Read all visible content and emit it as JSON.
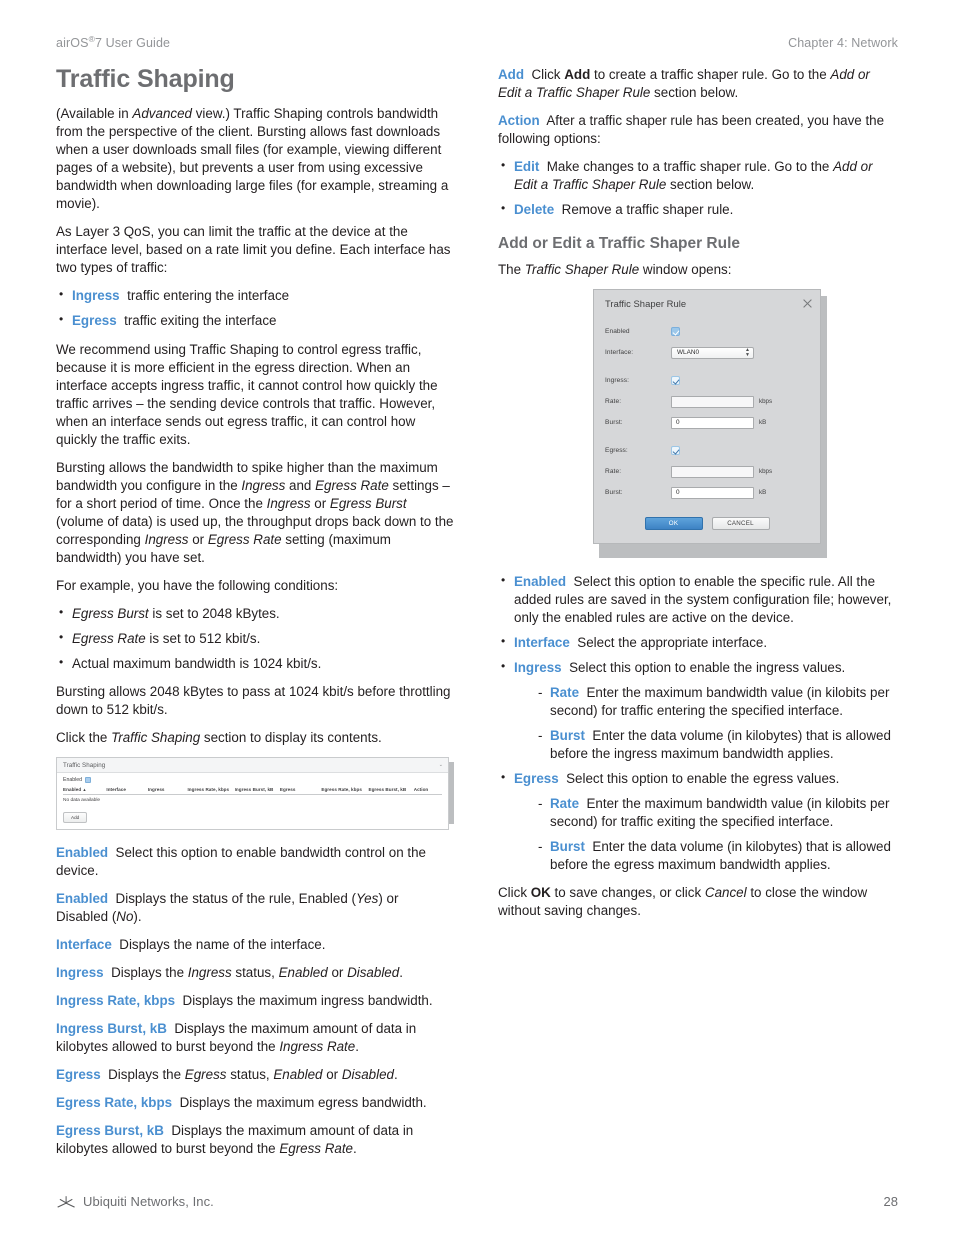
{
  "runhead": {
    "left_prefix": "airOS",
    "left_sup": "®",
    "left_suffix": "7 User Guide",
    "right": "Chapter 4: Network"
  },
  "left_column": {
    "title": "Traffic Shaping",
    "intro_p1_a": "(Available in ",
    "intro_p1_i": "Advanced",
    "intro_p1_b": " view.) Traffic Shaping controls bandwidth from the perspective of the client. Bursting allows fast downloads when a user downloads small files (for example, viewing different pages of a website), but prevents a user from using excessive bandwidth when downloading large files (for example, streaming a movie).",
    "qos_paragraph": "As Layer 3 QoS, you can limit the traffic at the device at the interface level, based on a rate limit you define. Each interface has two types of traffic:",
    "traffic_types": [
      {
        "term": "Ingress",
        "desc": "traffic entering the interface"
      },
      {
        "term": "Egress",
        "desc": "traffic exiting the interface"
      }
    ],
    "recommend_paragraph": "We recommend using Traffic Shaping to control egress traffic, because it is more efficient in the egress direction. When an interface accepts ingress traffic, it cannot control how quickly the traffic arrives – the sending device controls that traffic. However, when an interface sends out egress traffic, it can control how quickly the traffic exits.",
    "bursting_p_1": "Bursting allows the bandwidth to spike higher than the maximum bandwidth you configure in the ",
    "bursting_i_1": "Ingress",
    "bursting_p_2": " and ",
    "bursting_i_2": "Egress Rate",
    "bursting_p_3": " settings – for a short period of time. Once the ",
    "bursting_i_3": "Ingress",
    "bursting_p_4": " or ",
    "bursting_i_4": "Egress Burst",
    "bursting_p_5": " (volume of data) is used up, the throughput drops back down to the corresponding ",
    "bursting_i_5": "Ingress",
    "bursting_p_6": " or ",
    "bursting_i_6": "Egress Rate",
    "bursting_p_7": " setting (maximum bandwidth) you have set.",
    "example_intro": "For example, you have the following conditions:",
    "conditions": [
      {
        "i": "Egress Burst",
        "rest": " is set to 2048 kBytes."
      },
      {
        "i": "Egress Rate",
        "rest": " is set to 512 kbit/s."
      },
      {
        "i": "",
        "rest": "Actual maximum bandwidth is 1024 kbit/s."
      }
    ],
    "bursting_summary": "Bursting allows 2048 kBytes to pass at 1024 kbit/s before throttling down to 512 kbit/s.",
    "click_section_a": "Click the ",
    "click_section_i": "Traffic Shaping",
    "click_section_b": " section to display its contents.",
    "definitions": [
      {
        "term": "Enabled",
        "desc": "Select this option to enable bandwidth control on the device."
      },
      {
        "term": "Enabled",
        "desc_a": "Displays the status of the rule, Enabled (",
        "desc_i1": "Yes",
        "desc_b": ") or Disabled (",
        "desc_i2": "No",
        "desc_c": ")."
      },
      {
        "term": "Interface",
        "desc": "Displays the name of the interface."
      },
      {
        "term": "Ingress",
        "desc_a": "Displays the ",
        "desc_i1": "Ingress",
        "desc_b": " status, ",
        "desc_i2": "Enabled",
        "desc_c": " or ",
        "desc_i3": "Disabled",
        "desc_d": "."
      },
      {
        "term": "Ingress Rate, kbps",
        "desc": "Displays the maximum ingress bandwidth."
      },
      {
        "term": "Ingress Burst, kB",
        "desc_a": "Displays the maximum amount of data in kilobytes allowed to burst beyond the ",
        "desc_i1": "Ingress Rate",
        "desc_b": "."
      },
      {
        "term": "Egress",
        "desc_a": "Displays the ",
        "desc_i1": "Egress",
        "desc_b": " status, ",
        "desc_i2": "Enabled",
        "desc_c": " or ",
        "desc_i3": "Disabled",
        "desc_d": "."
      },
      {
        "term": "Egress Rate, kbps",
        "desc": "Displays the maximum egress bandwidth."
      },
      {
        "term": "Egress Burst, kB",
        "desc_a": "Displays the maximum amount of data in kilobytes allowed to burst beyond the ",
        "desc_i1": "Egress Rate",
        "desc_b": "."
      }
    ]
  },
  "traffic_shaping_panel": {
    "title": "Traffic Shaping",
    "collapse_caret": "⌄",
    "enabled_label": "Enabled",
    "enabled_checked": true,
    "columns": [
      "Enabled",
      "Interface",
      "Ingress",
      "Ingress Rate, kbps",
      "Ingress Burst, kB",
      "Egress",
      "Egress Rate, kbps",
      "Egress Burst, kB",
      "Action"
    ],
    "sort_indicator": "▲",
    "empty_message": "No data available",
    "add_button": "Add"
  },
  "right_column": {
    "add_term": "Add",
    "add_desc_a": "Click ",
    "add_desc_b": "Add",
    "add_desc_c": " to create a traffic shaper rule. Go to the ",
    "add_desc_i": "Add or Edit a Traffic Shaper Rule",
    "add_desc_d": " section below.",
    "action_term": "Action",
    "action_desc": "After a traffic shaper rule has been created, you have the following options:",
    "action_options": [
      {
        "term": "Edit",
        "desc_a": "Make changes to a traffic shaper rule. Go to the ",
        "desc_i": "Add or Edit a Traffic Shaper Rule",
        "desc_b": " section below."
      },
      {
        "term": "Delete",
        "desc_a": "Remove a traffic shaper rule.",
        "desc_i": "",
        "desc_b": ""
      }
    ],
    "section_heading": "Add or Edit a Traffic Shaper Rule",
    "window_intro_a": "The ",
    "window_intro_i": "Traffic Shaper Rule",
    "window_intro_b": " window opens:",
    "rule_options": [
      {
        "term": "Enabled",
        "desc": "Select this option to enable the specific rule. All the added rules are saved in the system configuration file; however, only the enabled rules are active on the device."
      },
      {
        "term": "Interface",
        "desc": "Select the appropriate interface."
      },
      {
        "term": "Ingress",
        "desc": "Select this option to enable the ingress values."
      }
    ],
    "ingress_sub": [
      {
        "term": "Rate",
        "desc": "Enter the maximum bandwidth value (in kilobits per second) for traffic entering the specified interface."
      },
      {
        "term": "Burst",
        "desc": "Enter the data volume (in kilobytes) that is allowed before the ingress maximum bandwidth applies."
      }
    ],
    "egress_option": {
      "term": "Egress",
      "desc": "Select this option to enable the egress values."
    },
    "egress_sub": [
      {
        "term": "Rate",
        "desc": "Enter the maximum bandwidth value (in kilobits per second) for traffic exiting the specified interface."
      },
      {
        "term": "Burst",
        "desc": "Enter the data volume (in kilobytes) that is allowed before the egress maximum bandwidth applies."
      }
    ],
    "closing_a": "Click ",
    "closing_b": "OK",
    "closing_c": " to save changes, or click ",
    "closing_i": "Cancel",
    "closing_d": " to close the window without saving changes."
  },
  "dialog": {
    "title": "Traffic Shaper Rule",
    "close_icon": "×",
    "fields": {
      "enabled_label": "Enabled",
      "enabled_checked": true,
      "interface_label": "Interface:",
      "interface_value": "WLAN0",
      "ingress_label": "Ingress:",
      "ingress_checked": true,
      "ingress_rate_label": "Rate:",
      "ingress_rate_value": "",
      "ingress_rate_unit": "kbps",
      "ingress_burst_label": "Burst:",
      "ingress_burst_value": "0",
      "ingress_burst_unit": "kB",
      "egress_label": "Egress:",
      "egress_checked": true,
      "egress_rate_label": "Rate:",
      "egress_rate_value": "",
      "egress_rate_unit": "kbps",
      "egress_burst_label": "Burst:",
      "egress_burst_value": "0",
      "egress_burst_unit": "kB"
    },
    "ok_button": "OK",
    "cancel_button": "CANCEL"
  },
  "footer": {
    "company": "Ubiquiti Networks, Inc.",
    "page_number": "28"
  },
  "colors": {
    "term_blue": "#4a8fd0",
    "heading_gray": "#6d6e71",
    "body": "#231f20",
    "runhead_gray": "#939598",
    "primary_button": "#3d82c4"
  }
}
